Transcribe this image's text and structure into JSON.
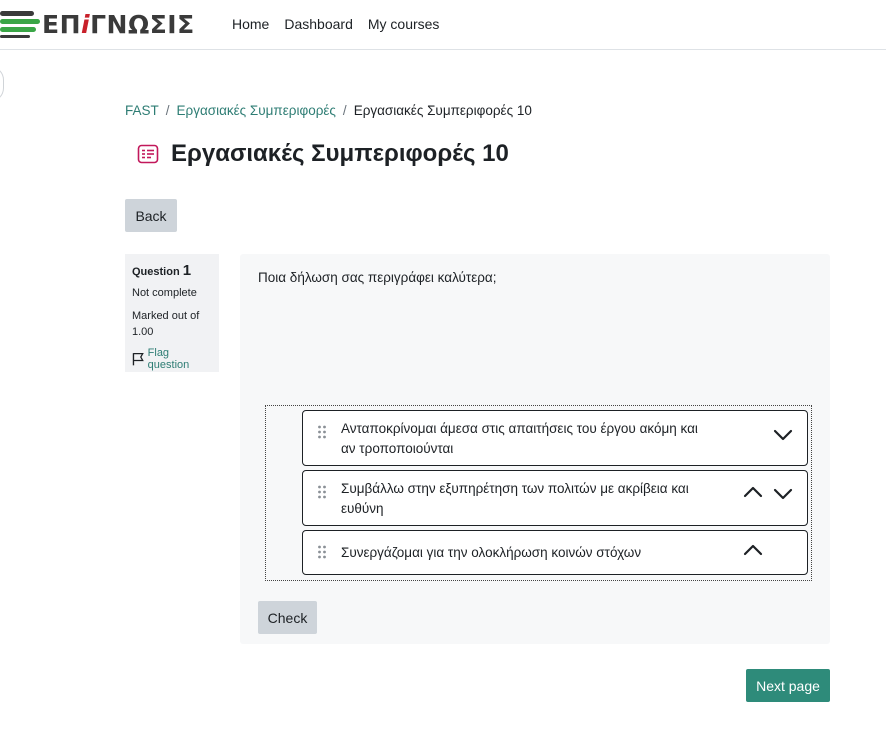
{
  "brand": {
    "prefix": "ΕΠ",
    "accent": "i",
    "suffix": "ΓΝΩΣΙΣ"
  },
  "nav": {
    "home": "Home",
    "dashboard": "Dashboard",
    "my_courses": "My courses"
  },
  "breadcrumb": [
    {
      "label": "FAST"
    },
    {
      "label": "Εργασιακές Συμπεριφορές"
    },
    {
      "label": "Εργασιακές Συμπεριφορές 10"
    }
  ],
  "breadcrumb_separator": "/",
  "page": {
    "title": "Εργασιακές Συμπεριφορές 10",
    "back_label": "Back",
    "next_label": "Next page"
  },
  "question_info": {
    "question_word": "Question",
    "number": "1",
    "state": "Not complete",
    "grade_line1": "Marked out of",
    "grade_line2": "1.00",
    "flag_label": "Flag question"
  },
  "question": {
    "text": "Ποια δήλωση σας περιγράφει καλύτερα;",
    "items": [
      {
        "line1": "Ανταποκρίνομαι άμεσα στις απαιτήσεις του έργου ακόμη και",
        "line2": "αν τροποποιούνται"
      },
      {
        "line1": "Συμβάλλω στην εξυπηρέτηση των πολιτών με ακρίβεια και",
        "line2": "ευθύνη"
      },
      {
        "line1": "Συνεργάζομαι για την ολοκλήρωση κοινών στόχων",
        "line2": ""
      }
    ],
    "check_label": "Check"
  },
  "colors": {
    "accent": "#2e7d74",
    "primary_button": "#2e8b7a",
    "secondary_button": "#ced4da",
    "quiz_icon": "#c2185b"
  },
  "icons": {
    "quiz": "quiz-icon",
    "flag": "flag-icon",
    "grip": "drag-handle-icon",
    "up": "chevron-up-icon",
    "down": "chevron-down-icon"
  }
}
